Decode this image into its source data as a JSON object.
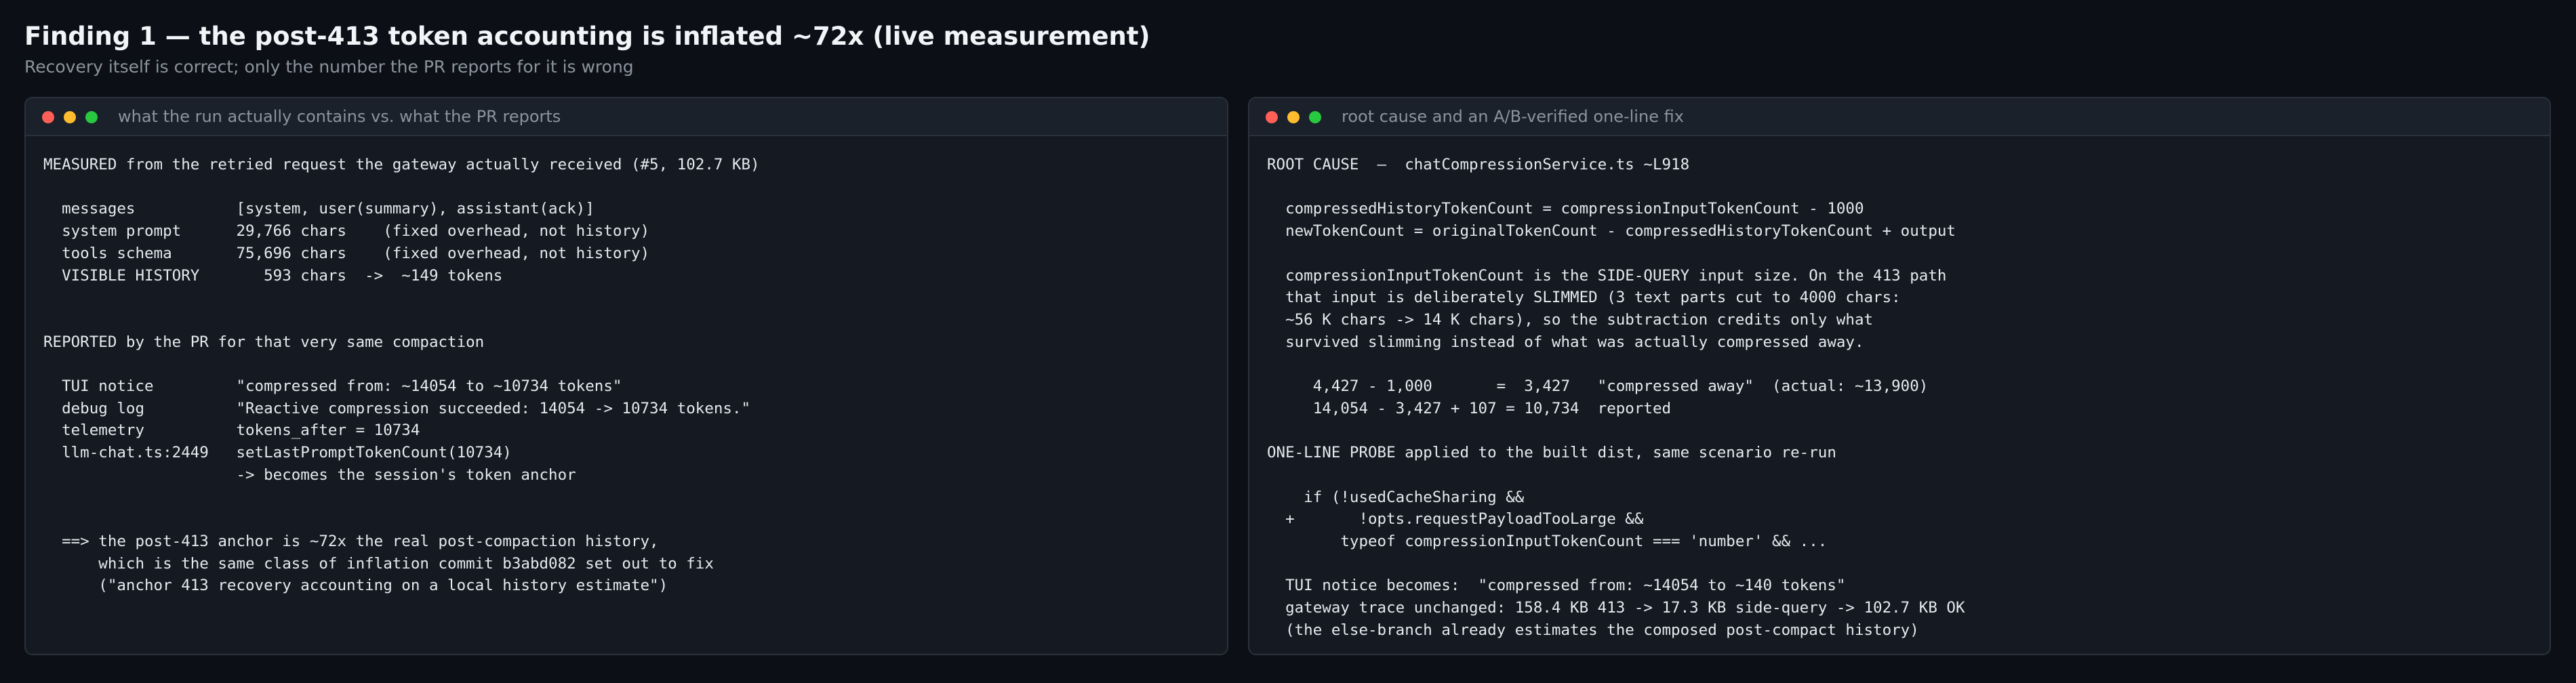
{
  "header": {
    "title": "Finding 1 — the post-413 token accounting is inflated ~72x (live measurement)",
    "subtitle": "Recovery itself is correct; only the number the PR reports for it is wrong"
  },
  "colors": {
    "background": "#0c1016",
    "panel": "#151a22",
    "titlebar": "#1b212a",
    "dot_red": "#ff5f57",
    "dot_yellow": "#febc2e",
    "dot_green": "#28c840"
  },
  "left_panel": {
    "window_title": "what the run actually contains vs. what the PR reports",
    "lines": [
      "MEASURED from the retried request the gateway actually received (#5, 102.7 KB)",
      "",
      "  messages           [system, user(summary), assistant(ack)]",
      "  system prompt      29,766 chars    (fixed overhead, not history)",
      "  tools schema       75,696 chars    (fixed overhead, not history)",
      "  VISIBLE HISTORY       593 chars  ->  ~149 tokens",
      "",
      "",
      "REPORTED by the PR for that very same compaction",
      "",
      "  TUI notice         \"compressed from: ~14054 to ~10734 tokens\"",
      "  debug log          \"Reactive compression succeeded: 14054 -> 10734 tokens.\"",
      "  telemetry          tokens_after = 10734",
      "  llm-chat.ts:2449   setLastPromptTokenCount(10734)",
      "                     -> becomes the session's token anchor",
      "",
      "",
      "  ==> the post-413 anchor is ~72x the real post-compaction history,",
      "      which is the same class of inflation commit b3abd082 set out to fix",
      "      (\"anchor 413 recovery accounting on a local history estimate\")"
    ]
  },
  "right_panel": {
    "window_title": "root cause and an A/B-verified one-line fix",
    "lines": [
      "ROOT CAUSE  —  chatCompressionService.ts ~L918",
      "",
      "  compressedHistoryTokenCount = compressionInputTokenCount - 1000",
      "  newTokenCount = originalTokenCount - compressedHistoryTokenCount + output",
      "",
      "  compressionInputTokenCount is the SIDE-QUERY input size. On the 413 path",
      "  that input is deliberately SLIMMED (3 text parts cut to 4000 chars:",
      "  ~56 K chars -> 14 K chars), so the subtraction credits only what",
      "  survived slimming instead of what was actually compressed away.",
      "",
      "     4,427 - 1,000       =  3,427   \"compressed away\"  (actual: ~13,900)",
      "     14,054 - 3,427 + 107 = 10,734  reported",
      "",
      "ONE-LINE PROBE applied to the built dist, same scenario re-run",
      "",
      "    if (!usedCacheSharing &&",
      "  +       !opts.requestPayloadTooLarge &&",
      "        typeof compressionInputTokenCount === 'number' && ...",
      "",
      "  TUI notice becomes:  \"compressed from: ~14054 to ~140 tokens\"",
      "  gateway trace unchanged: 158.4 KB 413 -> 17.3 KB side-query -> 102.7 KB OK",
      "  (the else-branch already estimates the composed post-compact history)"
    ]
  }
}
